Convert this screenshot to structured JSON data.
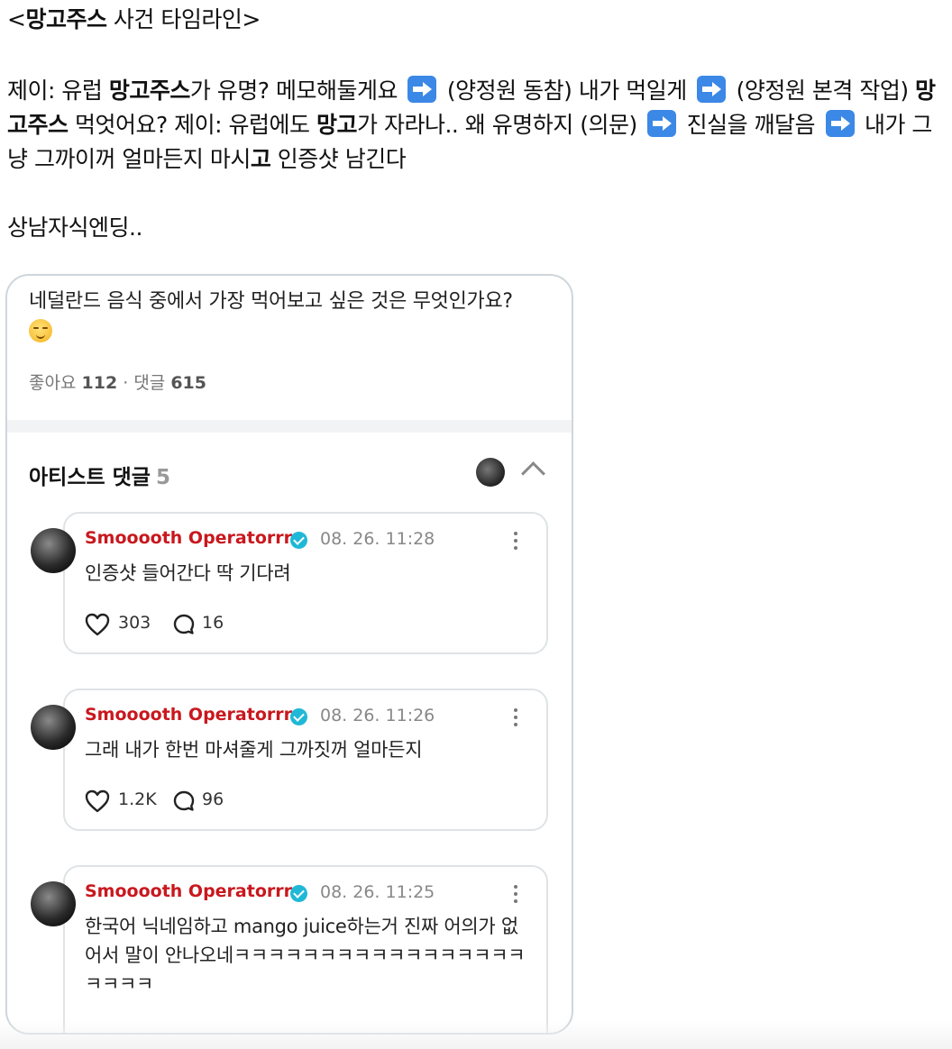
{
  "post": {
    "title_open": "<",
    "title_bold": "망고주스",
    "title_rest": " 사건 타임라인>",
    "body": [
      {
        "t": "제이: 유럽 "
      },
      {
        "b": "망고주스"
      },
      {
        "t": "가 유명? 메모해둘게요 "
      },
      {
        "arrow": "arrow-icon"
      },
      {
        "t": " (양정원 동참) 내가 먹일게 "
      },
      {
        "arrow": "arrow-icon"
      },
      {
        "t": " (양정원 본격 작업) "
      },
      {
        "b": "망고주스"
      },
      {
        "t": " 먹엇어요? 제이: 유럽에도 "
      },
      {
        "b": "망고"
      },
      {
        "t": "가 자라나.. 왜 유명하지 (의문) "
      },
      {
        "arrow": "arrow-icon"
      },
      {
        "t": " 진실을 깨달음 "
      },
      {
        "arrow": "arrow-icon"
      },
      {
        "t": " 내가 그냥 그까이꺼 얼마든지 마시"
      },
      {
        "b": "고"
      },
      {
        "t": " 인증샷 남긴다"
      }
    ],
    "ending": "상남자식엔딩.."
  },
  "card": {
    "question": "네덜란드 음식 중에서 가장 먹어보고 싶은 것은 무엇인가요?",
    "likes_label": "좋아요",
    "likes_count": "112",
    "comments_label": "댓글",
    "comments_count": "615",
    "section_title": "아티스트 댓글",
    "section_count": "5",
    "comments": [
      {
        "name": "Smooooth Operatorrrr",
        "time": "08. 26. 11:28",
        "text": "인증샷 들어간다 딱 기다려",
        "likes": "303",
        "replies": "16"
      },
      {
        "name": "Smooooth Operatorrrr",
        "time": "08. 26. 11:26",
        "text": "그래 내가 한번 마셔줄게 그까짓꺼 얼마든지",
        "likes": "1.2K",
        "replies": "96"
      },
      {
        "name": "Smooooth Operatorrrr",
        "time": "08. 26. 11:25",
        "text": "한국어 닉네임하고 mango juice하는거 진짜 어의가 없어서 말이 안나오네ㅋㅋㅋㅋㅋㅋㅋㅋㅋㅋㅋㅋㅋㅋㅋㅋㅋㅋㅋㅋㅋ",
        "likes": "",
        "replies": ""
      }
    ]
  },
  "colors": {
    "accent_name": "#c8181e",
    "verified": "#1fb8d6",
    "arrow": "#3b88e6"
  }
}
